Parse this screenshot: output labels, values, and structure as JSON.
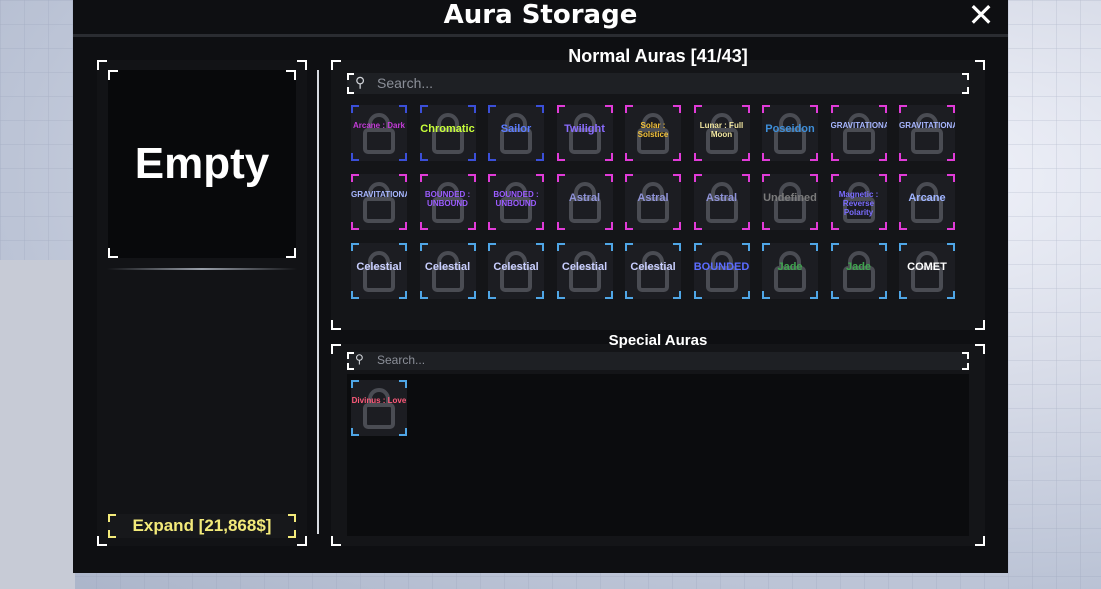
{
  "window": {
    "title": "Aura Storage",
    "close_label": "✕"
  },
  "equipped": {
    "empty_label": "Empty",
    "expand_label": "Expand [21,868$]"
  },
  "normal": {
    "title": "Normal Auras [41/43]",
    "search_placeholder": "Search...",
    "tiles": [
      {
        "label": "Arcane : Dark",
        "color": "#c43bd8",
        "frame": "blue",
        "row": 0,
        "col": 0
      },
      {
        "label": "Chromatic",
        "color": "#c8ff3a",
        "frame": "blue",
        "row": 0,
        "col": 1
      },
      {
        "label": "Sailor",
        "color": "#5b7bff",
        "frame": "blue",
        "row": 0,
        "col": 2
      },
      {
        "label": "Twilight",
        "color": "#8a6cff",
        "frame": "pink",
        "row": 0,
        "col": 3
      },
      {
        "label": "Solar : Solstice",
        "color": "#f3c23a",
        "frame": "pink",
        "row": 0,
        "col": 4
      },
      {
        "label": "Lunar : Full Moon",
        "color": "#f1e6a0",
        "frame": "pink",
        "row": 0,
        "col": 5
      },
      {
        "label": "Poseidon",
        "color": "#3e8ed8",
        "frame": "pink",
        "row": 0,
        "col": 6
      },
      {
        "label": "GRAVITATIONAL",
        "color": "#a7b6ff",
        "frame": "pink",
        "row": 0,
        "col": 7
      },
      {
        "label": "GRAVITATIONAL",
        "color": "#a7b6ff",
        "frame": "pink",
        "row": 0,
        "col": 8
      },
      {
        "label": "GRAVITATIONAL",
        "color": "#a7b6ff",
        "frame": "pink",
        "row": 1,
        "col": 0
      },
      {
        "label": "BOUNDED : UNBOUND",
        "color": "#9b5cff",
        "frame": "pink",
        "row": 1,
        "col": 1
      },
      {
        "label": "BOUNDED : UNBOUND",
        "color": "#9b5cff",
        "frame": "pink",
        "row": 1,
        "col": 2
      },
      {
        "label": "Astral",
        "color": "#8f93d8",
        "frame": "pink",
        "row": 1,
        "col": 3
      },
      {
        "label": "Astral",
        "color": "#8f93d8",
        "frame": "pink",
        "row": 1,
        "col": 4
      },
      {
        "label": "Astral",
        "color": "#8f93d8",
        "frame": "pink",
        "row": 1,
        "col": 5
      },
      {
        "label": "Undefined",
        "color": "#7a7a7a",
        "frame": "pink",
        "row": 1,
        "col": 6
      },
      {
        "label": "Magnetic : Reverse Polarity",
        "color": "#7a6cff",
        "frame": "pink",
        "row": 1,
        "col": 7
      },
      {
        "label": "Arcane",
        "color": "#9fb4ff",
        "frame": "pink",
        "row": 1,
        "col": 8
      },
      {
        "label": "Celestial",
        "color": "#c9cfff",
        "frame": "cyan",
        "row": 2,
        "col": 0
      },
      {
        "label": "Celestial",
        "color": "#c9cfff",
        "frame": "cyan",
        "row": 2,
        "col": 1
      },
      {
        "label": "Celestial",
        "color": "#c9cfff",
        "frame": "cyan",
        "row": 2,
        "col": 2
      },
      {
        "label": "Celestial",
        "color": "#c9cfff",
        "frame": "cyan",
        "row": 2,
        "col": 3
      },
      {
        "label": "Celestial",
        "color": "#c9cfff",
        "frame": "cyan",
        "row": 2,
        "col": 4
      },
      {
        "label": "BOUNDED",
        "color": "#5b6cff",
        "frame": "cyan",
        "row": 2,
        "col": 5
      },
      {
        "label": "Jade",
        "color": "#3fa34e",
        "frame": "cyan",
        "row": 2,
        "col": 6
      },
      {
        "label": "Jade",
        "color": "#3fa34e",
        "frame": "cyan",
        "row": 2,
        "col": 7
      },
      {
        "label": "COMET",
        "color": "#ffffff",
        "frame": "cyan",
        "row": 2,
        "col": 8
      }
    ]
  },
  "special": {
    "title": "Special Auras",
    "search_placeholder": "Search...",
    "tiles": [
      {
        "label": "Divinus : Love",
        "color": "#ff5a7a",
        "frame": "cyan",
        "row": 0,
        "col": 0
      }
    ]
  }
}
